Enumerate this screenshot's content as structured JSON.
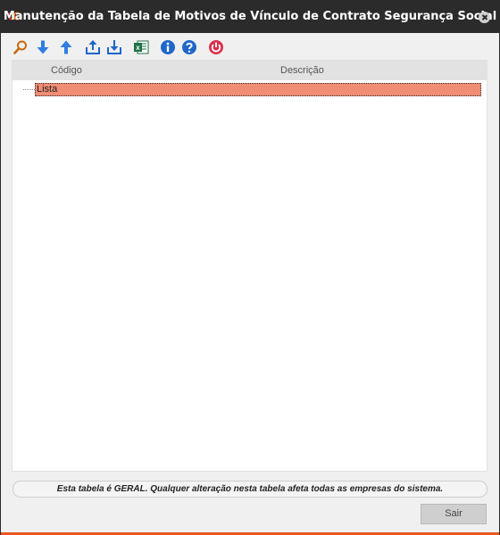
{
  "window": {
    "title": "Manutenção da Tabela de Motivos de Vínculo de Contrato Segurança Social",
    "accent_color": "#e8581c",
    "titlebar_color": "#2b2b2b"
  },
  "toolbar": {
    "icons": [
      "search-icon",
      "arrow-down-icon",
      "arrow-up-icon",
      "export-icon",
      "import-icon",
      "excel-icon",
      "info-icon",
      "help-icon",
      "power-icon"
    ]
  },
  "grid": {
    "columns": [
      "Código",
      "Descrição"
    ],
    "rows": [
      {
        "label": "Lista",
        "selected": true,
        "highlight_color": "#f08d75"
      }
    ]
  },
  "footer": {
    "message": "Esta tabela é GERAL. Qualquer alteração nesta tabela afeta todas as empresas do sistema."
  },
  "buttons": {
    "exit_label": "Sair"
  }
}
